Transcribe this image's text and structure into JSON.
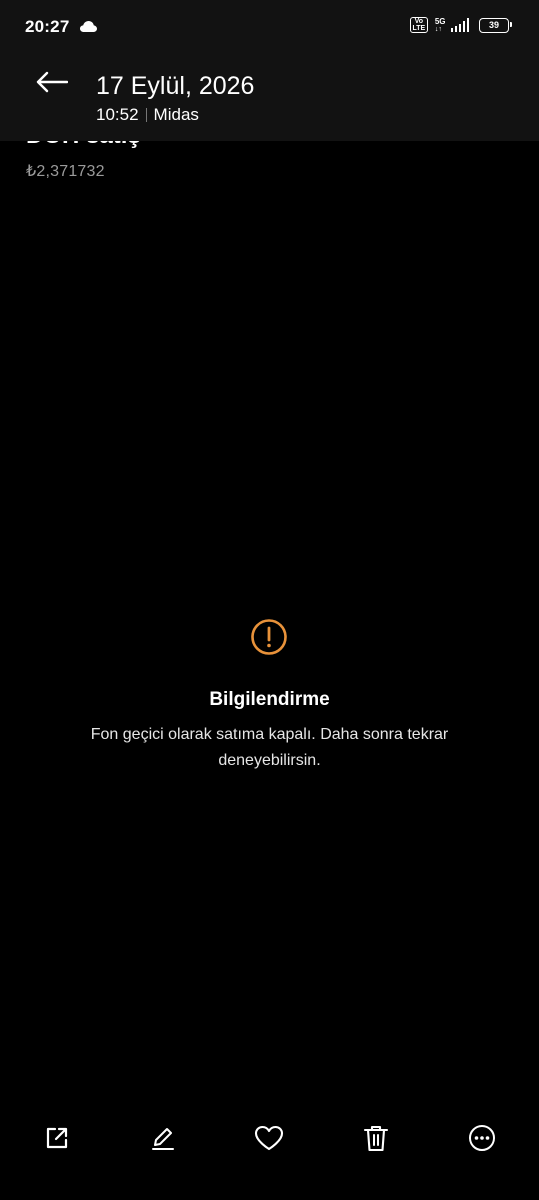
{
  "status_bar": {
    "time": "20:27",
    "volte_top": "Vo",
    "volte_bottom": "LTE",
    "network": "5G",
    "network_arrows": "↓↑",
    "battery": "39",
    "icons": [
      "cloud-icon",
      "volte-icon",
      "signal-icon",
      "battery-icon"
    ]
  },
  "header": {
    "date": "17 Eylül, 2026",
    "time": "10:52",
    "source": "Midas",
    "back_icon": "arrow-left-icon"
  },
  "content": {
    "title": "DOH satış",
    "price": "₺2,371732"
  },
  "info": {
    "icon": "exclamation-circle-icon",
    "icon_color": "#E8923A",
    "title": "Bilgilendirme",
    "message": "Fon geçici olarak satıma kapalı. Daha sonra tekrar deneyebilirsin."
  },
  "toolbar": {
    "items": [
      {
        "name": "share",
        "icon": "share-icon"
      },
      {
        "name": "edit",
        "icon": "pencil-icon"
      },
      {
        "name": "favorite",
        "icon": "heart-icon"
      },
      {
        "name": "delete",
        "icon": "trash-icon"
      },
      {
        "name": "more",
        "icon": "more-icon"
      }
    ]
  }
}
